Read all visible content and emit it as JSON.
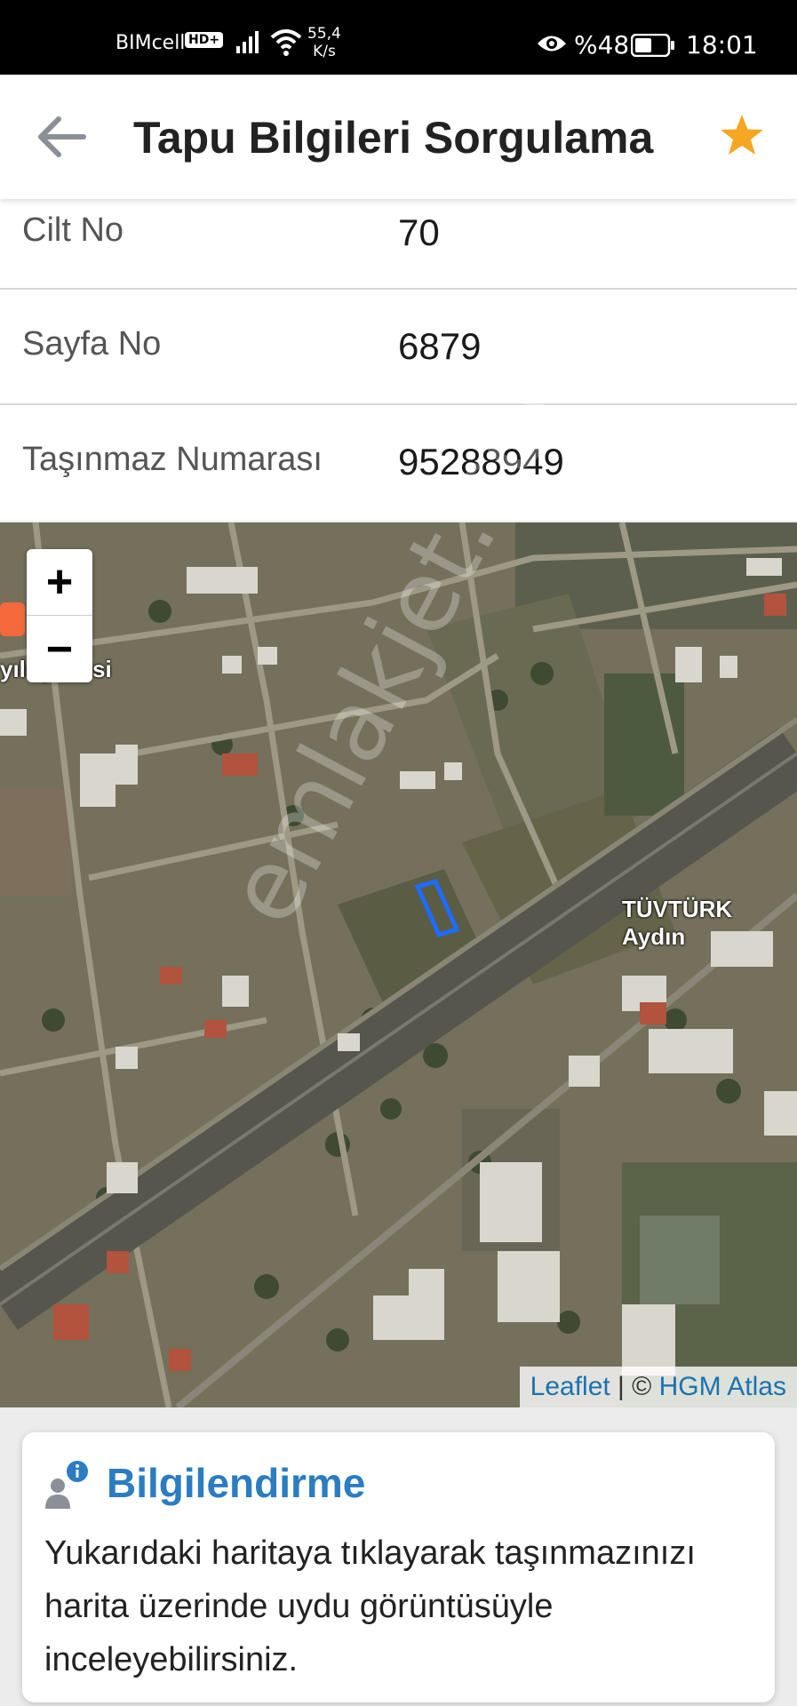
{
  "status_bar": {
    "carrier": "BIMcell",
    "hd_badge": "HD+",
    "network_speed_value": "55,4",
    "network_speed_unit": "K/s",
    "battery_percent": "%48",
    "time": "18:01",
    "icons": [
      "signal-icon",
      "wifi-icon",
      "eye-icon",
      "battery-icon"
    ]
  },
  "app_bar": {
    "title": "Tapu Bilgileri Sorgulama",
    "back_icon": "arrow-left-icon",
    "favorite_icon": "star-icon",
    "accent_color": "#f5a623"
  },
  "details": [
    {
      "label": "Cilt No",
      "value": "70"
    },
    {
      "label": "Sayfa No",
      "value": "6879"
    },
    {
      "label": "Taşınmaz Numarası",
      "value": "95288949"
    }
  ],
  "map": {
    "zoom_in": "+",
    "zoom_out": "−",
    "labels": {
      "branch": "yılı şubesi",
      "tuvturk": "TÜVTÜRK Aydın"
    },
    "watermark": "emlakjet.com",
    "attribution": {
      "leaflet": "Leaflet",
      "separator": " | © ",
      "provider": "HGM Atlas"
    },
    "parcel_color": "#1e6bff"
  },
  "info_card": {
    "title": "Bilgilendirme",
    "icon": "user-info-icon",
    "text": "Yukarıdaki haritaya tıklayarak taşınmazınızı harita üzerinde uydu görüntüsüyle inceleyebilirsiniz.",
    "title_color": "#2b7cc1"
  }
}
